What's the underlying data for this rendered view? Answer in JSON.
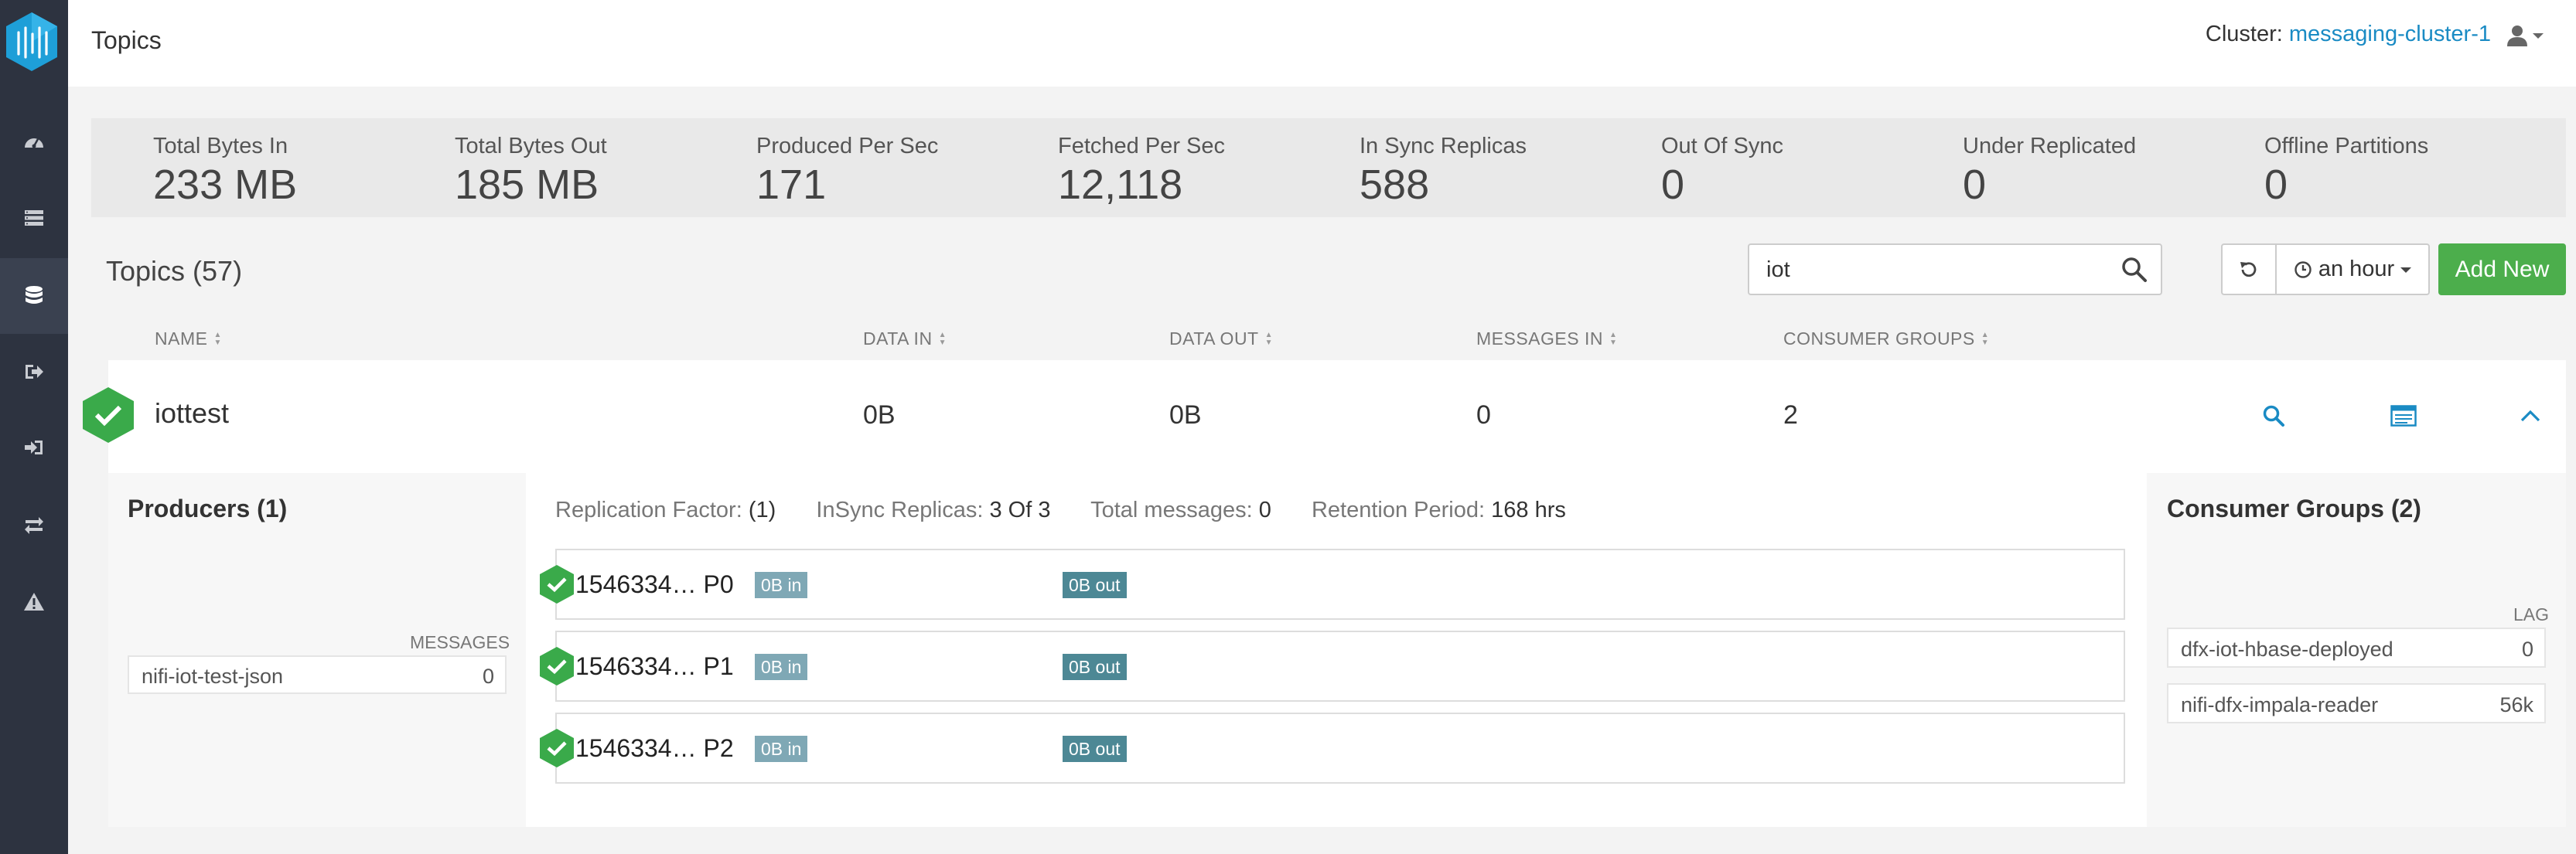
{
  "header": {
    "title": "Topics",
    "cluster_label": "Cluster:",
    "cluster_name": "messaging-cluster-1"
  },
  "nav": {
    "items": [
      "dashboard-icon",
      "brokers-icon",
      "topics-icon",
      "producers-icon",
      "consumers-icon",
      "replication-icon",
      "alerts-icon"
    ],
    "active": "topics-icon"
  },
  "stats": [
    {
      "label": "Total Bytes In",
      "value": "233 MB"
    },
    {
      "label": "Total Bytes Out",
      "value": "185 MB"
    },
    {
      "label": "Produced Per Sec",
      "value": "171"
    },
    {
      "label": "Fetched Per Sec",
      "value": "12,118"
    },
    {
      "label": "In Sync Replicas",
      "value": "588"
    },
    {
      "label": "Out Of Sync",
      "value": "0"
    },
    {
      "label": "Under Replicated",
      "value": "0"
    },
    {
      "label": "Offline Partitions",
      "value": "0"
    }
  ],
  "topics_header": {
    "title": "Topics (57)",
    "search_value": "iot",
    "range_label": "an hour",
    "add_label": "Add New"
  },
  "columns": [
    "NAME",
    "DATA IN",
    "DATA OUT",
    "MESSAGES IN",
    "CONSUMER GROUPS"
  ],
  "topic": {
    "name": "iottest",
    "data_in": "0B",
    "data_out": "0B",
    "messages_in": "0",
    "consumer_groups": "2"
  },
  "producers": {
    "title": "Producers (1)",
    "messages_header": "MESSAGES",
    "items": [
      {
        "name": "nifi-iot-test-json",
        "messages": "0"
      }
    ]
  },
  "meta": {
    "replication_label": "Replication Factor:",
    "replication_value": "(1)",
    "insync_label": "InSync Replicas:",
    "insync_value": "3 Of 3",
    "total_label": "Total messages:",
    "total_value": "0",
    "retention_label": "Retention Period:",
    "retention_value": "168 hrs"
  },
  "partitions": [
    {
      "name": "1546334… P0",
      "in": "0B in",
      "out": "0B out"
    },
    {
      "name": "1546334… P1",
      "in": "0B in",
      "out": "0B out"
    },
    {
      "name": "1546334… P2",
      "in": "0B in",
      "out": "0B out"
    }
  ],
  "consumer_groups": {
    "title": "Consumer Groups (2)",
    "lag_header": "LAG",
    "items": [
      {
        "name": "dfx-iot-hbase-deployed",
        "lag": "0"
      },
      {
        "name": "nifi-dfx-impala-reader",
        "lag": "56k"
      }
    ]
  },
  "colors": {
    "sidebar": "#2d3340",
    "accent": "#1a8bc4",
    "success": "#4cae4c",
    "check": "#3aaa4a"
  }
}
